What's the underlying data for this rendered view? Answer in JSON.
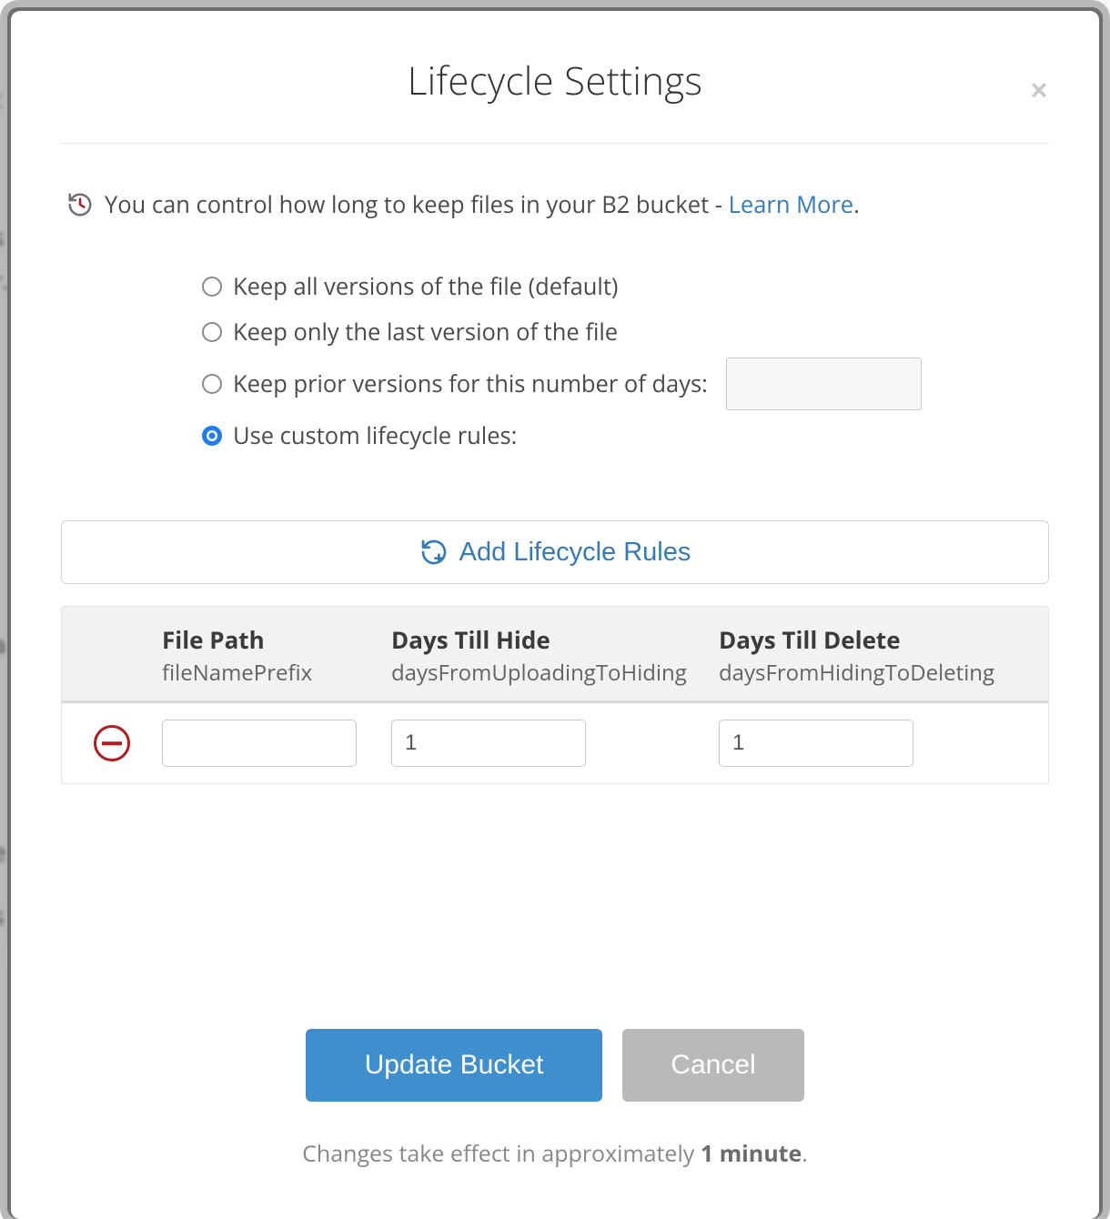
{
  "header": {
    "title": "Lifecycle Settings"
  },
  "description": {
    "text_before": "You can control how long to keep files in your B2 bucket - ",
    "link": "Learn More",
    "text_after": "."
  },
  "options": {
    "keep_all": "Keep all versions of the file (default)",
    "keep_last": "Keep only the last version of the file",
    "keep_prior_days": "Keep prior versions for this number of days:",
    "use_custom": "Use custom lifecycle rules:",
    "prior_days_value": ""
  },
  "rules": {
    "add_button": "Add Lifecycle Rules",
    "columns": {
      "file_path": {
        "title": "File Path",
        "sub": "fileNamePrefix"
      },
      "days_hide": {
        "title": "Days Till Hide",
        "sub": "daysFromUploadingToHiding"
      },
      "days_delete": {
        "title": "Days Till Delete",
        "sub": "daysFromHidingToDeleting"
      }
    },
    "rows": [
      {
        "file_path": "",
        "days_hide": "1",
        "days_delete": "1"
      }
    ]
  },
  "footer": {
    "update": "Update Bucket",
    "cancel": "Cancel",
    "note_before": "Changes take effect in approximately ",
    "note_bold": "1 minute",
    "note_after": "."
  }
}
